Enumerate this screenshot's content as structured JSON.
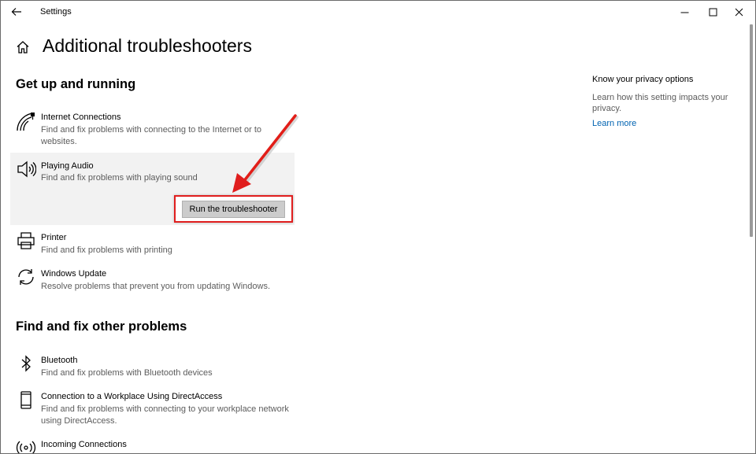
{
  "window": {
    "title": "Settings",
    "back_icon": "back-arrow-icon",
    "controls": [
      "minimize-icon",
      "maximize-icon",
      "close-icon"
    ]
  },
  "header": {
    "title": "Additional troubleshooters",
    "icon": "home-icon"
  },
  "sections": {
    "get_up": {
      "title": "Get up and running",
      "items": [
        {
          "icon": "wifi-signal-icon",
          "title": "Internet Connections",
          "desc": "Find and fix problems with connecting to the Internet or to websites."
        },
        {
          "icon": "speaker-icon",
          "title": "Playing Audio",
          "desc": "Find and fix problems with playing sound",
          "button": "Run the troubleshooter",
          "selected": true
        },
        {
          "icon": "printer-icon",
          "title": "Printer",
          "desc": "Find and fix problems with printing"
        },
        {
          "icon": "refresh-icon",
          "title": "Windows Update",
          "desc": "Resolve problems that prevent you from updating Windows."
        }
      ]
    },
    "other": {
      "title": "Find and fix other problems",
      "items": [
        {
          "icon": "bluetooth-icon",
          "title": "Bluetooth",
          "desc": "Find and fix problems with Bluetooth devices"
        },
        {
          "icon": "phone-icon",
          "title": "Connection to a Workplace Using DirectAccess",
          "desc": "Find and fix problems with connecting to your workplace network using DirectAccess."
        },
        {
          "icon": "antenna-icon",
          "title": "Incoming Connections",
          "desc": ""
        }
      ]
    }
  },
  "side_panel": {
    "title": "Know your privacy options",
    "text": "Learn how this setting impacts your privacy.",
    "link": "Learn more"
  },
  "colors": {
    "highlight_border": "#e01e1e",
    "link": "#0063b1",
    "selected_bg": "#f2f2f2",
    "button_bg": "#cccccc"
  }
}
